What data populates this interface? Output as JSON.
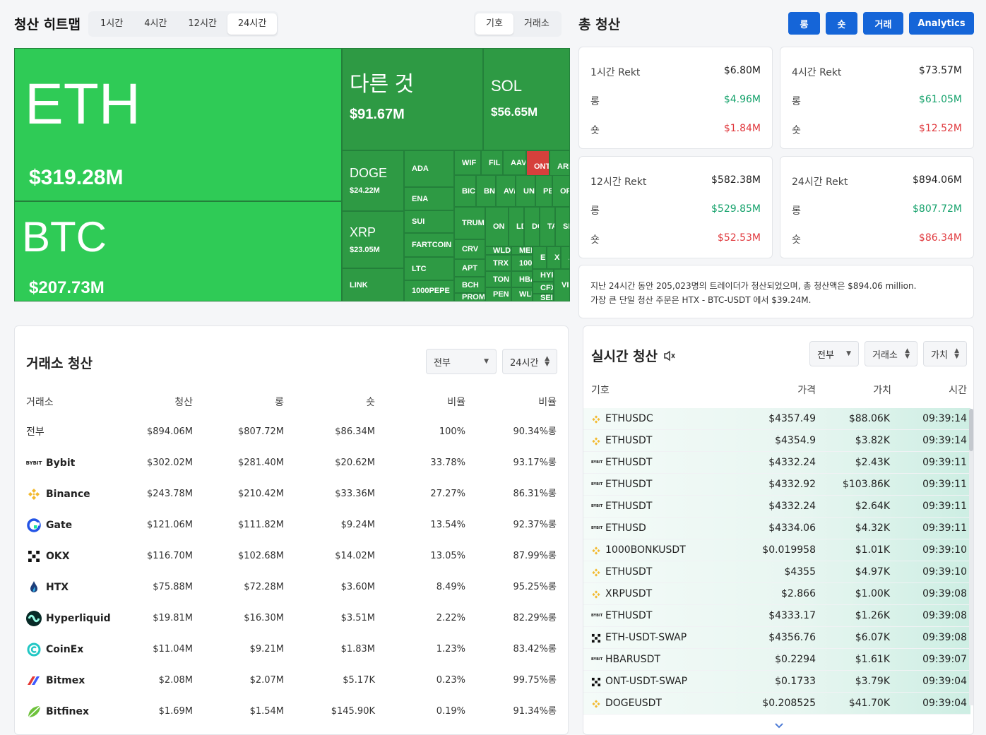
{
  "heatmap": {
    "title": "청산 히트맵",
    "time_tabs": [
      "1시간",
      "4시간",
      "12시간",
      "24시간"
    ],
    "active_tab": "24시간",
    "mode_tabs": [
      "기호",
      "거래소"
    ],
    "tiles": [
      {
        "symbol": "ETH",
        "value": "$319.28M"
      },
      {
        "symbol": "BTC",
        "value": "$207.73M"
      },
      {
        "symbol": "다른 것",
        "value": "$91.67M"
      },
      {
        "symbol": "SOL",
        "value": "$56.65M"
      },
      {
        "symbol": "DOGE",
        "value": "$24.22M"
      },
      {
        "symbol": "XRP",
        "value": "$23.05M"
      },
      {
        "symbol": "LINK"
      },
      {
        "symbol": "ADA"
      },
      {
        "symbol": "ENA"
      },
      {
        "symbol": "SUI"
      },
      {
        "symbol": "FARTCOIN"
      },
      {
        "symbol": "LTC"
      },
      {
        "symbol": "1000PEPE"
      },
      {
        "symbol": "WIF"
      },
      {
        "symbol": "FIL"
      },
      {
        "symbol": "AAV"
      },
      {
        "symbol": "ONT"
      },
      {
        "symbol": "ARE"
      },
      {
        "symbol": "BIC"
      },
      {
        "symbol": "BN"
      },
      {
        "symbol": "AV/"
      },
      {
        "symbol": "UN"
      },
      {
        "symbol": "PE"
      },
      {
        "symbol": "OF"
      },
      {
        "symbol": "TRUM"
      },
      {
        "symbol": "CRV"
      },
      {
        "symbol": "APT"
      },
      {
        "symbol": "BCH"
      },
      {
        "symbol": "PROM"
      },
      {
        "symbol": "ON"
      },
      {
        "symbol": "LD"
      },
      {
        "symbol": "DC"
      },
      {
        "symbol": "TA"
      },
      {
        "symbol": "SF"
      },
      {
        "symbol": "WLD"
      },
      {
        "symbol": "MEM"
      },
      {
        "symbol": "E"
      },
      {
        "symbol": "X"
      },
      {
        "symbol": "A"
      },
      {
        "symbol": "TRX"
      },
      {
        "symbol": "100"
      },
      {
        "symbol": "TON"
      },
      {
        "symbol": "HBA"
      },
      {
        "symbol": "PEN"
      },
      {
        "symbol": "WLF"
      },
      {
        "symbol": "HYP"
      },
      {
        "symbol": "CFX"
      },
      {
        "symbol": "SEI"
      },
      {
        "symbol": "VII"
      }
    ]
  },
  "totals": {
    "title": "총 청산",
    "buttons": [
      "롱",
      "숏",
      "거래",
      "Analytics"
    ],
    "cards": [
      {
        "title": "1시간 Rekt",
        "total": "$6.80M",
        "long_label": "롱",
        "long": "$4.96M",
        "short_label": "숏",
        "short": "$1.84M"
      },
      {
        "title": "4시간 Rekt",
        "total": "$73.57M",
        "long_label": "롱",
        "long": "$61.05M",
        "short_label": "숏",
        "short": "$12.52M"
      },
      {
        "title": "12시간 Rekt",
        "total": "$582.38M",
        "long_label": "롱",
        "long": "$529.85M",
        "short_label": "숏",
        "short": "$52.53M"
      },
      {
        "title": "24시간 Rekt",
        "total": "$894.06M",
        "long_label": "롱",
        "long": "$807.72M",
        "short_label": "숏",
        "short": "$86.34M"
      }
    ],
    "summary_line1": "지난 24시간 동안 205,023명의 트레이더가 청산되었으며, 총 청산액은 $894.06 million.",
    "summary_line2": "가장 큰 단일 청산 주문은 HTX - BTC-USDT 에서 $39.24M."
  },
  "exchange": {
    "title": "거래소 청산",
    "filter_value": "전부",
    "period_value": "24시간",
    "headers": [
      "거래소",
      "청산",
      "롱",
      "숏",
      "비율",
      "비율"
    ],
    "rows": [
      {
        "name": "전부",
        "total": "$894.06M",
        "long": "$807.72M",
        "short": "$86.34M",
        "share": "100%",
        "ratio": "90.34%롱"
      },
      {
        "name": "Bybit",
        "total": "$302.02M",
        "long": "$281.40M",
        "short": "$20.62M",
        "share": "33.78%",
        "ratio": "93.17%롱",
        "logo": "bybit"
      },
      {
        "name": "Binance",
        "total": "$243.78M",
        "long": "$210.42M",
        "short": "$33.36M",
        "share": "27.27%",
        "ratio": "86.31%롱",
        "logo": "binance"
      },
      {
        "name": "Gate",
        "total": "$121.06M",
        "long": "$111.82M",
        "short": "$9.24M",
        "share": "13.54%",
        "ratio": "92.37%롱",
        "logo": "gate"
      },
      {
        "name": "OKX",
        "total": "$116.70M",
        "long": "$102.68M",
        "short": "$14.02M",
        "share": "13.05%",
        "ratio": "87.99%롱",
        "logo": "okx"
      },
      {
        "name": "HTX",
        "total": "$75.88M",
        "long": "$72.28M",
        "short": "$3.60M",
        "share": "8.49%",
        "ratio": "95.25%롱",
        "logo": "htx"
      },
      {
        "name": "Hyperliquid",
        "total": "$19.81M",
        "long": "$16.30M",
        "short": "$3.51M",
        "share": "2.22%",
        "ratio": "82.29%롱",
        "logo": "hyperliquid"
      },
      {
        "name": "CoinEx",
        "total": "$11.04M",
        "long": "$9.21M",
        "short": "$1.83M",
        "share": "1.23%",
        "ratio": "83.42%롱",
        "logo": "coinex"
      },
      {
        "name": "Bitmex",
        "total": "$2.08M",
        "long": "$2.07M",
        "short": "$5.17K",
        "share": "0.23%",
        "ratio": "99.75%롱",
        "logo": "bitmex"
      },
      {
        "name": "Bitfinex",
        "total": "$1.69M",
        "long": "$1.54M",
        "short": "$145.90K",
        "share": "0.19%",
        "ratio": "91.34%롱",
        "logo": "bitfinex"
      }
    ]
  },
  "realtime": {
    "title": "실시간 청산",
    "filter_all": "전부",
    "filter_exchange": "거래소",
    "filter_value": "가치",
    "headers": [
      "기호",
      "가격",
      "가치",
      "시간"
    ],
    "rows": [
      {
        "symbol": "ETHUSDC",
        "price": "$4357.49",
        "value": "$88.06K",
        "time": "09:39:14",
        "ex": "binance"
      },
      {
        "symbol": "ETHUSDT",
        "price": "$4354.9",
        "value": "$3.82K",
        "time": "09:39:14",
        "ex": "binance"
      },
      {
        "symbol": "ETHUSDT",
        "price": "$4332.24",
        "value": "$2.43K",
        "time": "09:39:11",
        "ex": "bybit"
      },
      {
        "symbol": "ETHUSDT",
        "price": "$4332.92",
        "value": "$103.86K",
        "time": "09:39:11",
        "ex": "bybit"
      },
      {
        "symbol": "ETHUSDT",
        "price": "$4332.24",
        "value": "$2.64K",
        "time": "09:39:11",
        "ex": "bybit"
      },
      {
        "symbol": "ETHUSD",
        "price": "$4334.06",
        "value": "$4.32K",
        "time": "09:39:11",
        "ex": "bybit"
      },
      {
        "symbol": "1000BONKUSDT",
        "price": "$0.019958",
        "value": "$1.01K",
        "time": "09:39:10",
        "ex": "binance"
      },
      {
        "symbol": "ETHUSDT",
        "price": "$4355",
        "value": "$4.97K",
        "time": "09:39:10",
        "ex": "binance"
      },
      {
        "symbol": "XRPUSDT",
        "price": "$2.866",
        "value": "$1.00K",
        "time": "09:39:08",
        "ex": "binance"
      },
      {
        "symbol": "ETHUSDT",
        "price": "$4333.17",
        "value": "$1.26K",
        "time": "09:39:08",
        "ex": "bybit"
      },
      {
        "symbol": "ETH-USDT-SWAP",
        "price": "$4356.76",
        "value": "$6.07K",
        "time": "09:39:08",
        "ex": "okx"
      },
      {
        "symbol": "HBARUSDT",
        "price": "$0.2294",
        "value": "$1.61K",
        "time": "09:39:07",
        "ex": "bybit"
      },
      {
        "symbol": "ONT-USDT-SWAP",
        "price": "$0.1733",
        "value": "$3.79K",
        "time": "09:39:04",
        "ex": "okx"
      },
      {
        "symbol": "DOGEUSDT",
        "price": "$0.208525",
        "value": "$41.70K",
        "time": "09:39:04",
        "ex": "binance"
      }
    ]
  },
  "colors": {
    "primary": "#1565d8",
    "long": "#16a26c",
    "short": "#e0393e",
    "tile_large": "#2fcb56",
    "tile": "#2e9a44",
    "tile_red": "#d6403c"
  }
}
